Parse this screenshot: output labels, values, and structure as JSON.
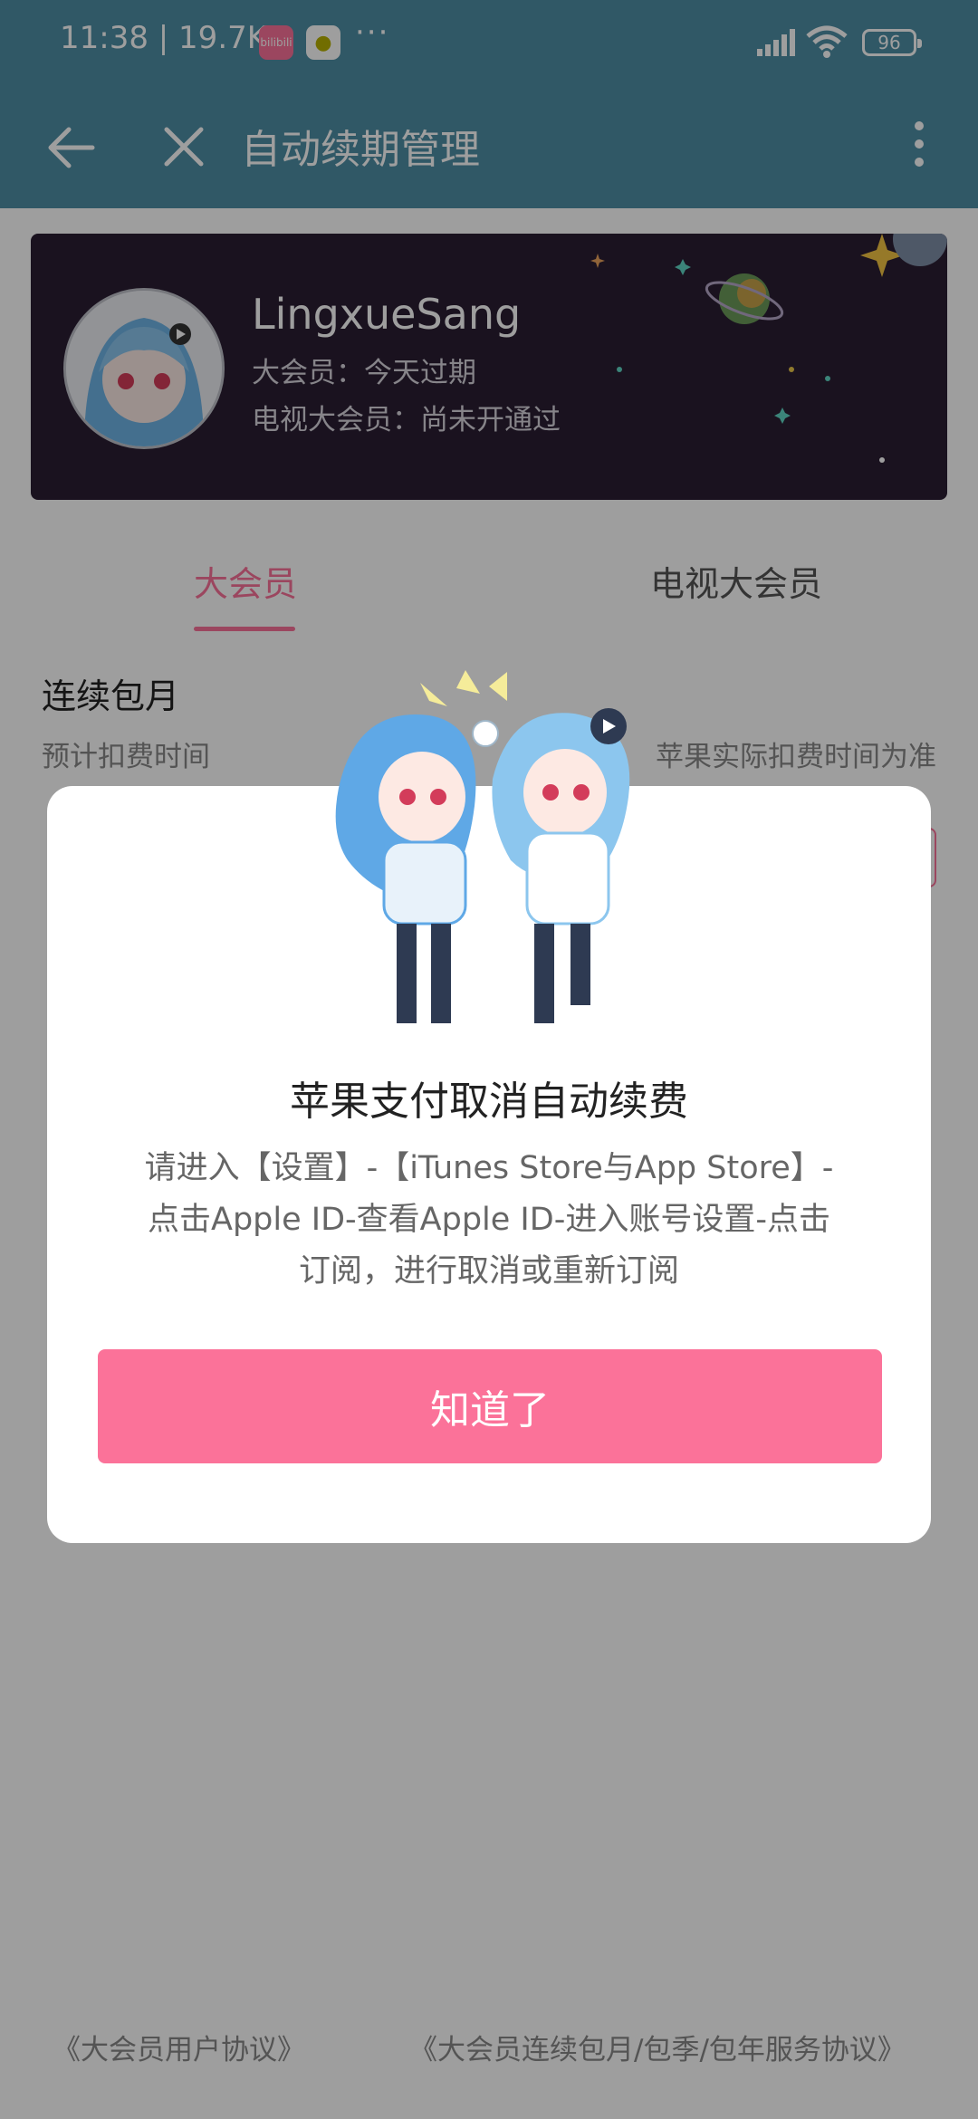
{
  "status_bar": {
    "time_speed": "11:38 | 19.7K/s",
    "app_icon_1": "bilibili",
    "more_dots": "···",
    "battery": "96"
  },
  "app_bar": {
    "title": "自动续期管理"
  },
  "profile": {
    "username": "LingxueSang",
    "vip_status": "大会员：今天过期",
    "tv_vip_status": "电视大会员：尚未开通过"
  },
  "tabs": [
    {
      "label": "大会员",
      "active": true
    },
    {
      "label": "电视大会员",
      "active": false
    }
  ],
  "subscription": {
    "section_title": "连续包月",
    "next_charge_label": "预计扣费时间",
    "next_charge_note": "苹果实际扣费时间为准"
  },
  "footer": {
    "user_agreement": "《大会员用户协议》",
    "service_agreement": "《大会员连续包月/包季/包年服务协议》"
  },
  "dialog": {
    "title": "苹果支付取消自动续费",
    "body_lines": [
      "请进入【设置】-【iTunes Store与App Store】-",
      "点击Apple ID-查看Apple ID-进入账号设置-点击",
      "订阅，进行取消或重新订阅"
    ],
    "button_label": "知道了"
  },
  "colors": {
    "header": "#4e8fa5",
    "accent_pink": "#fb7299",
    "banner_bg": "#2a1d33"
  }
}
